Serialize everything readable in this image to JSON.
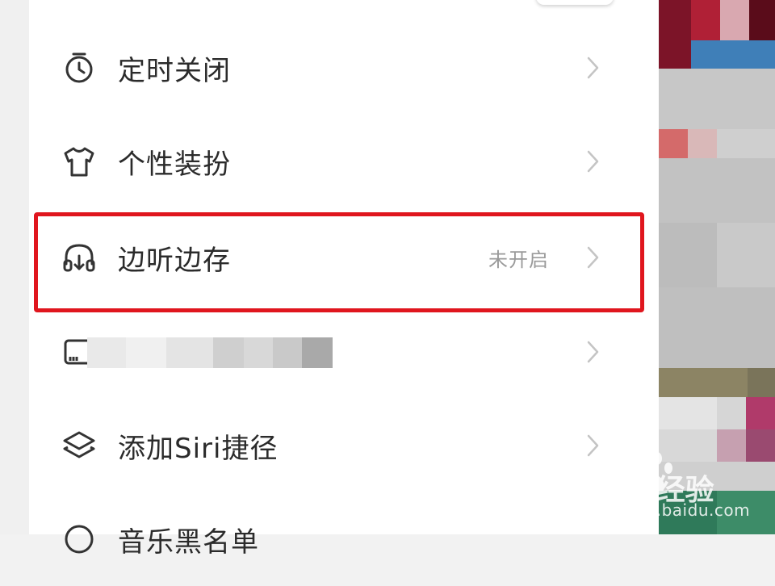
{
  "menu": {
    "items": [
      {
        "label": "定时关闭",
        "icon": "timer-icon",
        "status": ""
      },
      {
        "label": "个性装扮",
        "icon": "tshirt-icon",
        "status": ""
      },
      {
        "label": "边听边存",
        "icon": "headphones-download-icon",
        "status": "未开启"
      },
      {
        "label": "",
        "icon": "card-icon",
        "status": ""
      },
      {
        "label": "添加Siri捷径",
        "icon": "layers-icon",
        "status": ""
      },
      {
        "label": "音乐黑名单",
        "icon": "blocked-icon",
        "status": ""
      }
    ]
  },
  "watermark": {
    "brand": "Bai  经验",
    "url": "jingyan.baidu.com"
  },
  "colors": {
    "highlight": "#e0161e",
    "text": "#2b2b2b",
    "status": "#9a9a9a",
    "chevron": "#c4c4c4"
  }
}
